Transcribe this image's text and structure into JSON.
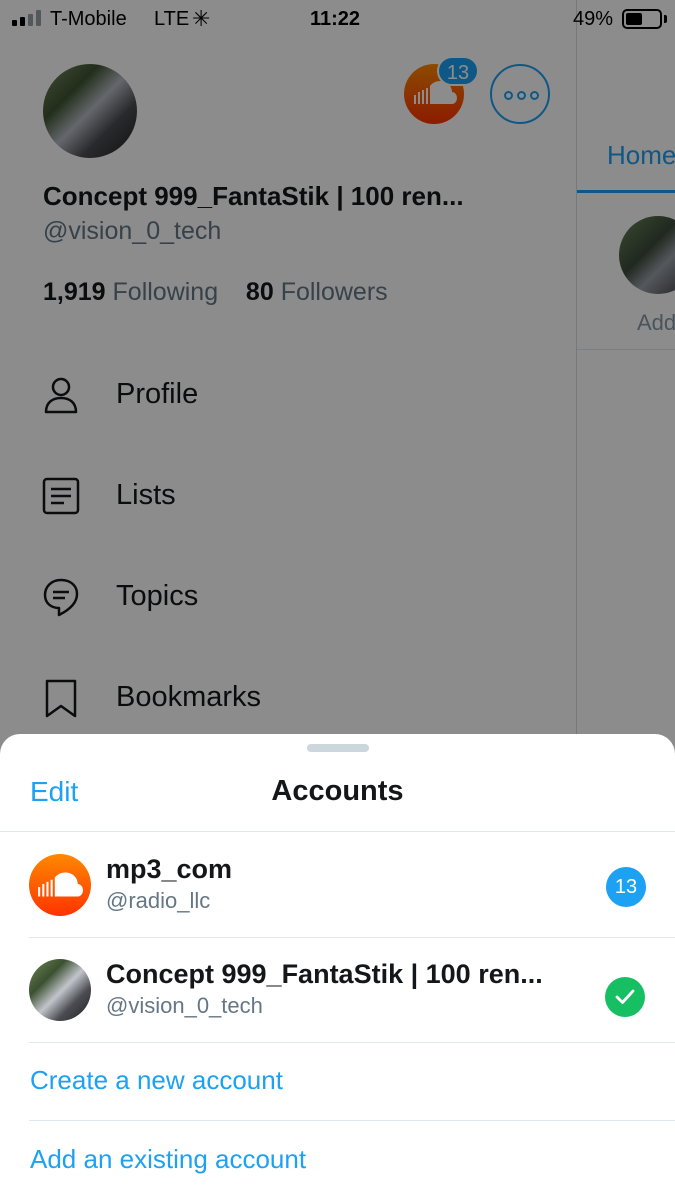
{
  "status_bar": {
    "carrier": "T-Mobile",
    "network": "LTE",
    "time": "11:22",
    "battery_percent": "49%",
    "battery_level": 0.49
  },
  "drawer": {
    "display_name": "Concept 999_FantaStik | 100 ren...",
    "handle": "@vision_0_tech",
    "following_count": "1,919",
    "following_label": "Following",
    "followers_count": "80",
    "followers_label": "Followers",
    "header_badge": "13",
    "menu": [
      {
        "label": "Profile",
        "icon": "person-icon"
      },
      {
        "label": "Lists",
        "icon": "list-icon"
      },
      {
        "label": "Topics",
        "icon": "topic-icon"
      },
      {
        "label": "Bookmarks",
        "icon": "bookmark-icon"
      }
    ]
  },
  "right_pane": {
    "tab": "Home",
    "add_label": "Add"
  },
  "sheet": {
    "edit_label": "Edit",
    "title": "Accounts",
    "accounts": [
      {
        "name": "mp3_com",
        "handle": "@radio_llc",
        "badge": "13",
        "avatar": "soundcloud-icon"
      },
      {
        "name": "Concept 999_FantaStik | 100 ren...",
        "handle": "@vision_0_tech",
        "status": "checkmark-icon"
      }
    ],
    "create_label": "Create a new account",
    "add_existing_label": "Add an existing account"
  },
  "colors": {
    "accent": "#1da1f2",
    "success": "#17bf63",
    "soundcloud": "#ff5500",
    "secondary_text": "#657786"
  }
}
